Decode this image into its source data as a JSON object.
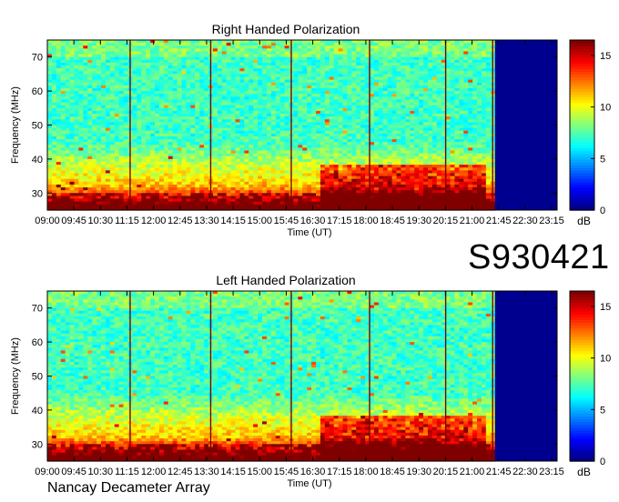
{
  "station_id": "S930421",
  "footer": "Nancay Decameter Array",
  "chart_data": [
    {
      "type": "heatmap",
      "title": "Right Handed Polarization",
      "xlabel": "Time (UT)",
      "ylabel": "Frequency (MHz)",
      "x_ticks": [
        "09:00",
        "09:45",
        "10:30",
        "11:15",
        "12:00",
        "12:45",
        "13:30",
        "14:15",
        "15:00",
        "15:45",
        "16:30",
        "17:15",
        "18:00",
        "18:45",
        "19:30",
        "20:15",
        "21:00",
        "21:45",
        "22:30",
        "23:15"
      ],
      "y_ticks": [
        30,
        40,
        50,
        60,
        70
      ],
      "ylim": [
        25,
        75
      ],
      "data_end": "21:45",
      "colorbar": {
        "label": "dB",
        "ticks": [
          0,
          5,
          10,
          15
        ],
        "range": [
          0,
          16.5
        ]
      }
    },
    {
      "type": "heatmap",
      "title": "Left Handed Polarization",
      "xlabel": "Time (UT)",
      "ylabel": "Frequency (MHz)",
      "x_ticks": [
        "09:00",
        "09:45",
        "10:30",
        "11:15",
        "12:00",
        "12:45",
        "13:30",
        "14:15",
        "15:00",
        "15:45",
        "16:30",
        "17:15",
        "18:00",
        "18:45",
        "19:30",
        "20:15",
        "21:00",
        "21:45",
        "22:30",
        "23:15"
      ],
      "y_ticks": [
        30,
        40,
        50,
        60,
        70
      ],
      "ylim": [
        25,
        75
      ],
      "data_end": "21:45",
      "colorbar": {
        "label": "dB",
        "ticks": [
          0,
          5,
          10,
          15
        ],
        "range": [
          0,
          16.5
        ]
      }
    }
  ]
}
